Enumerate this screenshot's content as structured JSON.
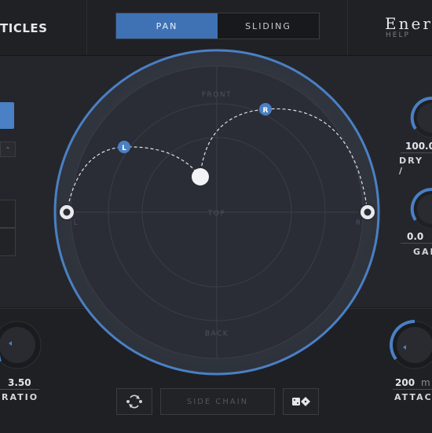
{
  "header": {
    "logo_text": "TICLES",
    "tabs": [
      {
        "label": "PAN",
        "active": true
      },
      {
        "label": "SLIDING",
        "active": false
      }
    ],
    "brand": "Enerc",
    "help": "HELP"
  },
  "panner": {
    "labels": {
      "front": "FRONT",
      "top": "TOP",
      "back": "BACK",
      "left": "L",
      "right": "R"
    },
    "nodes": {
      "left": "L",
      "right": "R"
    }
  },
  "right_panel": {
    "dry_wet": {
      "value": "100.0",
      "label": "DRY / "
    },
    "gain": {
      "value": "0.0",
      "label": "GAI"
    }
  },
  "compressor": {
    "ratio": {
      "value": "3.50",
      "label": "RATIO"
    },
    "attack": {
      "value": "200",
      "unit": "m",
      "label": "ATTAC"
    }
  },
  "footer": {
    "side_chain": "SIDE CHAIN"
  },
  "colors": {
    "accent": "#4a80c4",
    "bg": "#1c1d20"
  }
}
